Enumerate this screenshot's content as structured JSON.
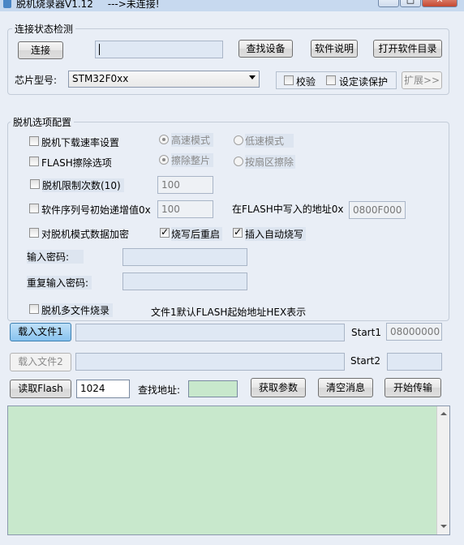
{
  "window": {
    "title": "脱机烧录器V1.12",
    "status": "--->未连接!",
    "minimize": "─",
    "maximize": "□",
    "close": "✕"
  },
  "connection": {
    "group_label": "连接状态检测",
    "connect_button": "连接",
    "device_field_value": "",
    "find_device_button": "查找设备",
    "software_help_button": "软件说明",
    "open_dir_button": "打开软件目录",
    "chip_label": "芯片型号:",
    "chip_value": "STM32F0xx",
    "verify_label": "校验",
    "read_protect_label": "设定读保护",
    "expand_button": "扩展>>"
  },
  "options": {
    "group_label": "脱机选项配置",
    "download_rate_label": "脱机下载速率设置",
    "high_speed_label": "高速模式",
    "low_speed_label": "低速模式",
    "flash_erase_label": "FLASH擦除选项",
    "erase_full_label": "擦除整片",
    "erase_sector_label": "按扇区擦除",
    "limit_count_label": "脱机限制次数(10)",
    "limit_count_value": "100",
    "serial_increment_label": "软件序列号初始递增值0x",
    "serial_increment_value": "100",
    "flash_addr_label": "在FLASH中写入的地址0x",
    "flash_addr_value": "0800F000",
    "encrypt_label": "对脱机模式数据加密",
    "restart_label": "烧写后重启",
    "auto_burn_label": "插入自动烧写",
    "password_label": "输入密码:",
    "password_value": "",
    "confirm_password_label": "重复输入密码:",
    "confirm_password_value": "",
    "multi_file_label": "脱机多文件烧录",
    "file_note": "文件1默认FLASH起始地址HEX表示"
  },
  "files": {
    "load_file1_button": "载入文件1",
    "file1_path": "",
    "start1_label": "Start1",
    "start1_value": "08000000",
    "load_file2_button": "载入文件2",
    "file2_path": "",
    "start2_label": "Start2",
    "start2_value": ""
  },
  "actions": {
    "read_flash_button": "读取Flash",
    "read_size_value": "1024",
    "find_addr_label": "查找地址:",
    "find_addr_value": "",
    "get_params_button": "获取参数",
    "clear_msg_button": "清空消息",
    "start_transfer_button": "开始传输"
  },
  "log": {
    "content": ""
  },
  "colors": {
    "background": "#e9eef6",
    "log_background": "#c8e8cc",
    "active_button": "#88c3ef"
  }
}
